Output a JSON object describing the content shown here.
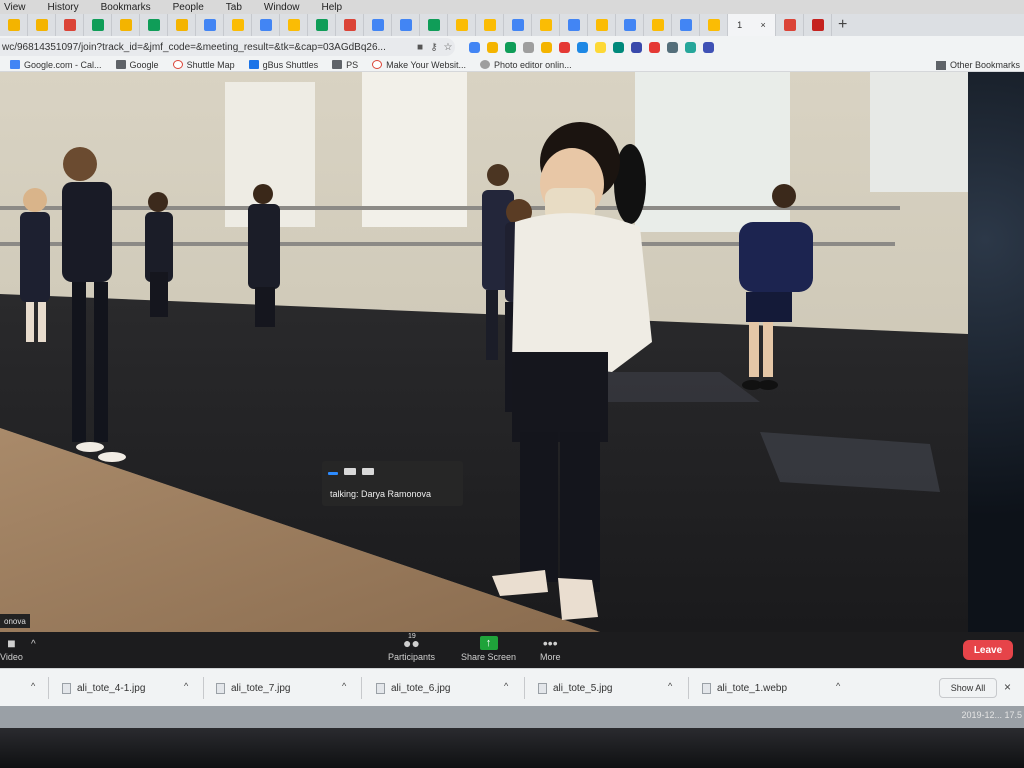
{
  "menubar": {
    "items": [
      "View",
      "History",
      "Bookmarks",
      "People",
      "Tab",
      "Window",
      "Help"
    ]
  },
  "tabs": {
    "active_label": "1",
    "active_close": "×",
    "new_tab": "+",
    "favicon_colors": [
      "#f4b400",
      "#f4b400",
      "#db4437",
      "#0f9d58",
      "#f4b400",
      "#0f9d58",
      "#f4b400",
      "#4285f4",
      "#fbbc04",
      "#4285f4",
      "#fbbc04",
      "#0f9d58",
      "#db4437",
      "#4285f4",
      "#4285f4",
      "#0f9d58",
      "#fbbc04",
      "#fbbc04",
      "#4285f4",
      "#fbbc04",
      "#4285f4",
      "#fbbc04",
      "#4285f4",
      "#fbbc04",
      "#4285f4",
      "#fbbc04",
      "#db4437",
      "#c5221f"
    ]
  },
  "address": {
    "url": "wc/96814351097/join?track_id=&jmf_code=&meeting_result=&tk=&cap=03AGdBq26...",
    "extension_colors": [
      "#4285f4",
      "#f4b400",
      "#0f9d58",
      "#9e9e9e",
      "#f4b400",
      "#e53935",
      "#1e88e5",
      "#fdd835",
      "#00897b",
      "#3949ab",
      "#e53935",
      "#546e7a",
      "#26a69a",
      "#3f51b5"
    ]
  },
  "bookmarks": {
    "items": [
      {
        "label": "Google.com - Cal...",
        "icon": "calendar-icon"
      },
      {
        "label": "Google",
        "icon": "folder-icon"
      },
      {
        "label": "Shuttle Map",
        "icon": "google-icon"
      },
      {
        "label": "gBus Shuttles",
        "icon": "gbus-icon"
      },
      {
        "label": "PS",
        "icon": "folder-icon"
      },
      {
        "label": "Make Your Websit...",
        "icon": "google-icon"
      },
      {
        "label": "Photo editor onlin...",
        "icon": "globe-icon"
      }
    ],
    "other": "Other Bookmarks"
  },
  "zoom": {
    "talking_text": "talking: Darya Ramonova",
    "nametag": "onova",
    "video_label": "Video",
    "participants_label": "Participants",
    "participants_count": "19",
    "share_label": "Share Screen",
    "more_label": "More",
    "leave_label": "Leave"
  },
  "downloads": {
    "files": [
      "ali_tote_4-1.jpg",
      "ali_tote_7.jpg",
      "ali_tote_6.jpg",
      "ali_tote_5.jpg",
      "ali_tote_1.webp"
    ],
    "show_all": "Show All",
    "close": "×"
  },
  "status": {
    "timestamp": "2019-12... 17.5"
  }
}
